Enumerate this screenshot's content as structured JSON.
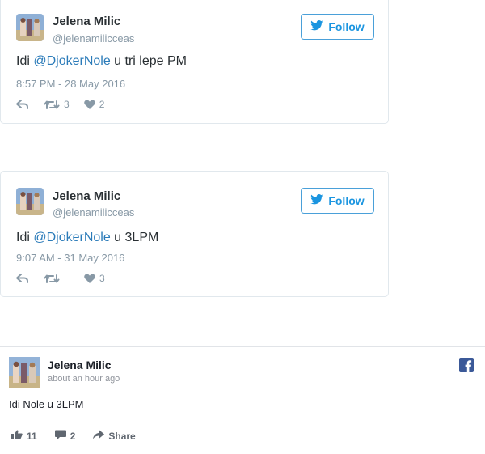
{
  "tweets": [
    {
      "author": "Jelena Milic",
      "handle": "@jelenamilicceas",
      "follow_label": "Follow",
      "text_before": "Idi ",
      "mention": "@DjokerNole",
      "text_after": " u tri lepe PM",
      "time": "8:57 PM - 28 May 2016",
      "retweets": "3",
      "likes": "2"
    },
    {
      "author": "Jelena Milic",
      "handle": "@jelenamilicceas",
      "follow_label": "Follow",
      "text_before": "Idi ",
      "mention": "@DjokerNole",
      "text_after": " u 3LPM",
      "time": "9:07 AM - 31 May 2016",
      "retweets": "",
      "likes": "3"
    }
  ],
  "facebook_post": {
    "author": "Jelena Milic",
    "time": "about an hour ago",
    "text": "Idi Nole u 3LPM",
    "likes": "11",
    "comments": "2",
    "share_label": "Share"
  },
  "colors": {
    "twitter_blue": "#1b95e0",
    "mention_blue": "#2b7bb9",
    "muted_gray": "#8899a6",
    "facebook_blue": "#3b5998"
  },
  "icons": [
    "twitter-bird-icon",
    "reply-icon",
    "retweet-icon",
    "heart-icon",
    "facebook-logo-icon",
    "like-icon",
    "comment-icon",
    "share-icon"
  ]
}
